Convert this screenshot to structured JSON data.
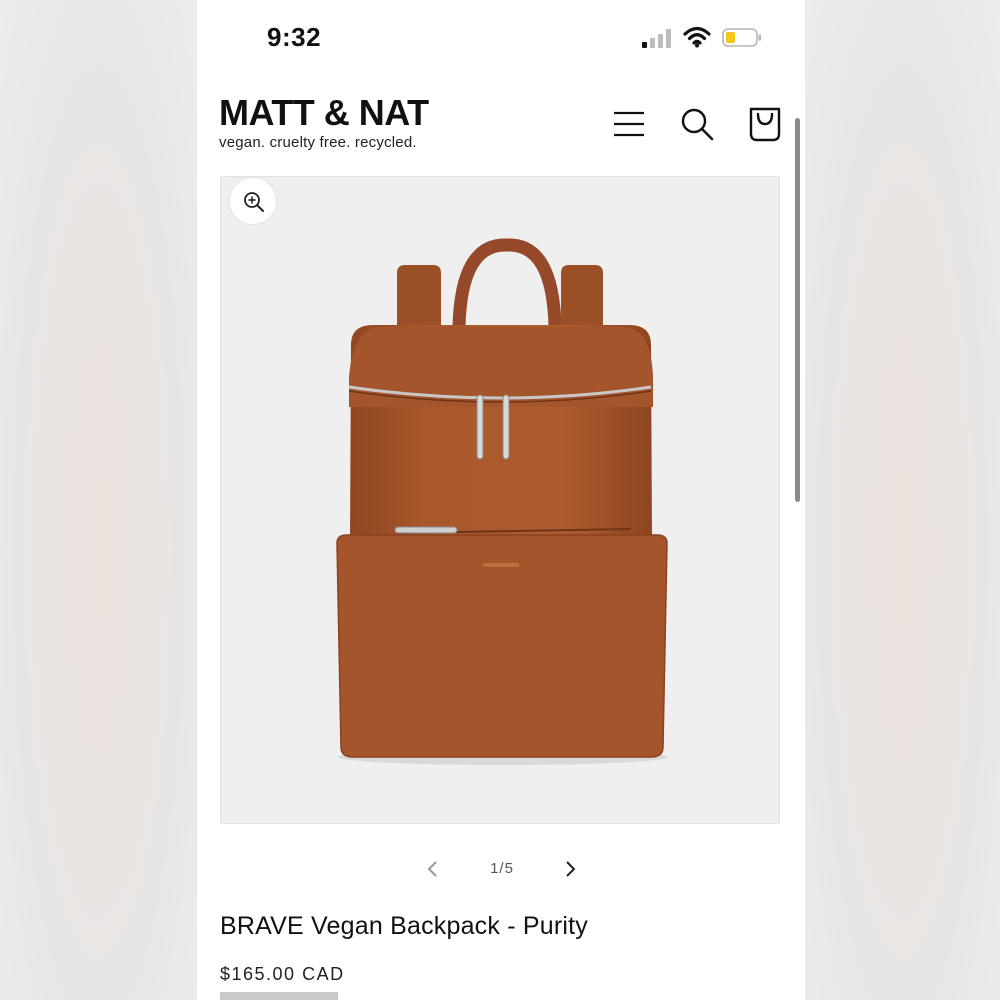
{
  "status_bar": {
    "time": "9:32",
    "signal_icon": "cellular-signal-icon",
    "wifi_icon": "wifi-icon",
    "battery_icon": "battery-low-icon",
    "battery_color": "#f5c518"
  },
  "header": {
    "brand_name": "MATT & NAT",
    "brand_tagline": "vegan. cruelty free. recycled.",
    "icons": [
      "menu-icon",
      "search-icon",
      "shopping-bag-icon"
    ]
  },
  "gallery": {
    "zoom_icon": "zoom-in-icon",
    "current": 1,
    "total": 5,
    "counter_text": "1/5",
    "prev_icon": "chevron-left-icon",
    "next_icon": "chevron-right-icon",
    "product_color": "#a8582b"
  },
  "product": {
    "title": "BRAVE Vegan Backpack - Purity",
    "price": "$165.00 CAD"
  }
}
